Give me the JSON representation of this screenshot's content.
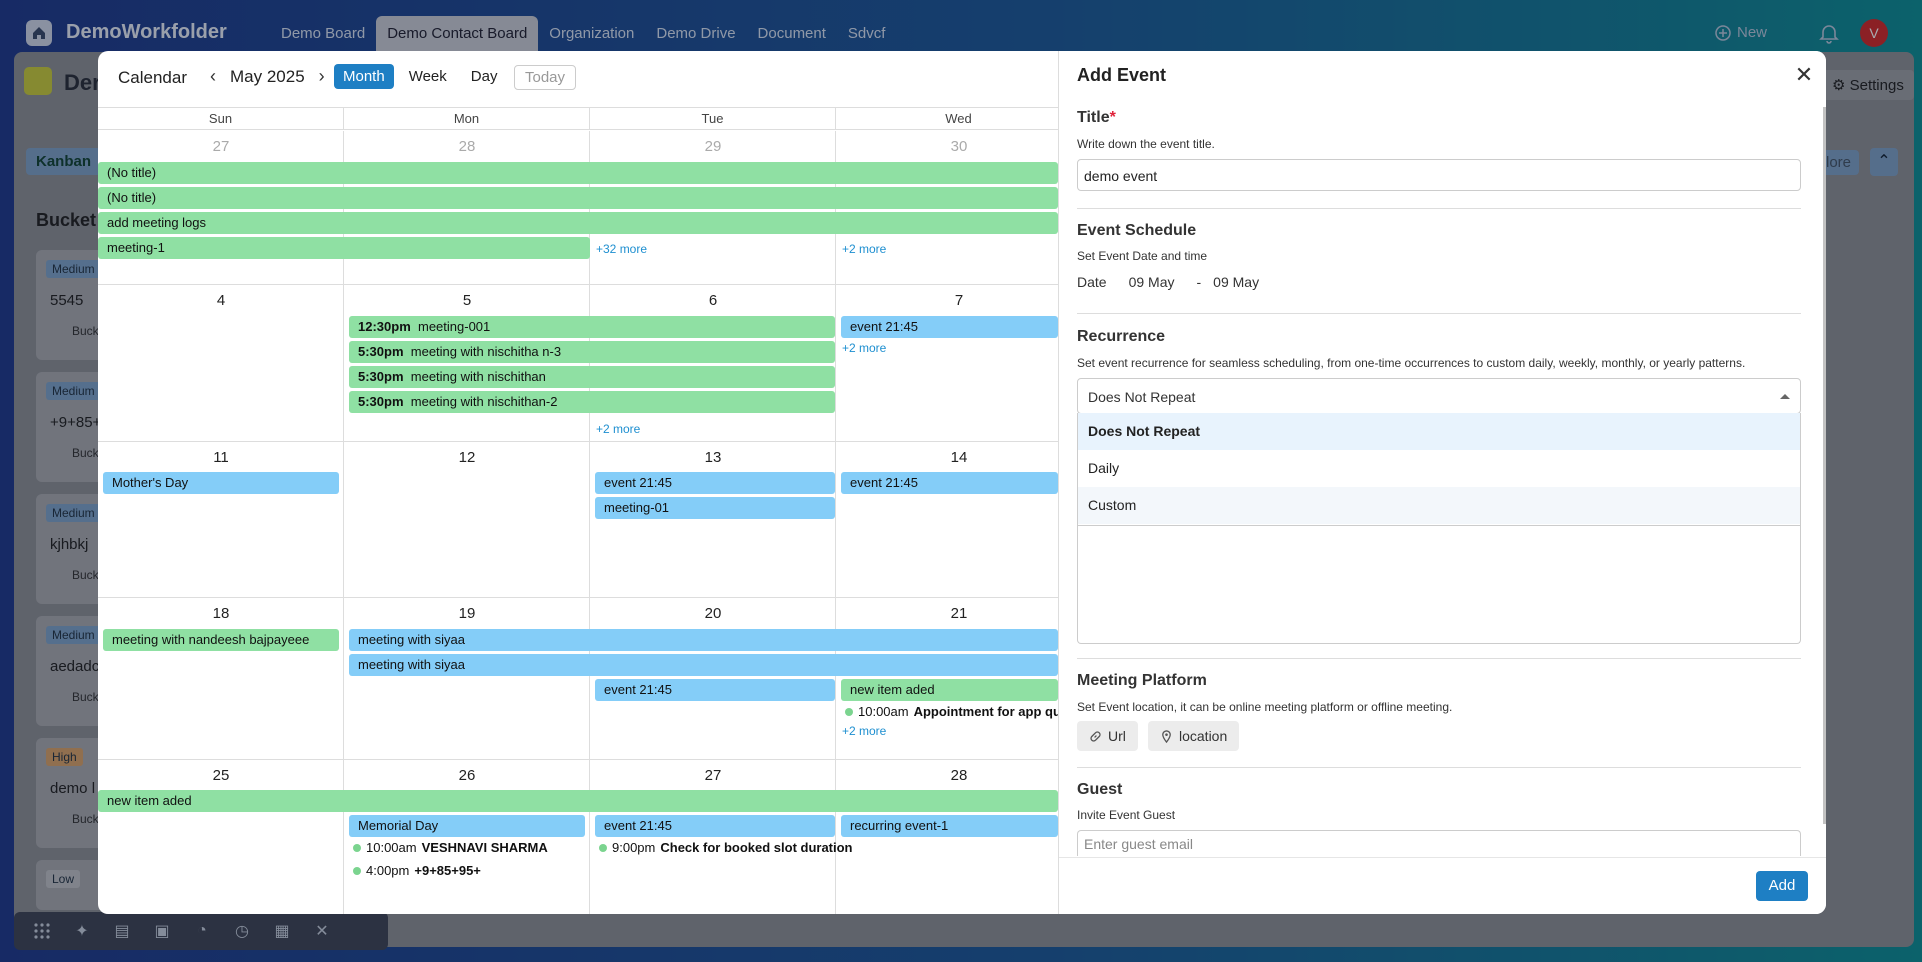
{
  "app": {
    "name": "DemoWorkfolder"
  },
  "nav_tabs": [
    {
      "label": "Demo Board"
    },
    {
      "label": "Demo Contact Board"
    },
    {
      "label": "Organization"
    },
    {
      "label": "Demo Drive"
    },
    {
      "label": "Document"
    },
    {
      "label": "Sdvcf"
    }
  ],
  "header_right": {
    "new_label": "New",
    "avatar_initial": "V"
  },
  "background": {
    "page_title_fragment": "Der",
    "settings_label": "Settings",
    "kanban_label": "Kanban",
    "more_fragment": "lore",
    "bucket_title": "Bucket",
    "cards": [
      {
        "priority": "Medium",
        "title": "5545",
        "bucket": "Buck"
      },
      {
        "priority": "Medium",
        "title": "+9+85+",
        "bucket": "Buck"
      },
      {
        "priority": "Medium",
        "title": "kjhbkj",
        "bucket": "Buck"
      },
      {
        "priority": "Medium",
        "title": "aedadc",
        "bucket": "Buck"
      },
      {
        "priority": "High",
        "title": "demo l",
        "bucket": "Buck"
      },
      {
        "priority": "Low",
        "title": "",
        "bucket": ""
      }
    ]
  },
  "calendar": {
    "title": "Calendar",
    "month_label": "May 2025",
    "views": [
      "Month",
      "Week",
      "Day"
    ],
    "active_view": "Month",
    "today_label": "Today",
    "days_of_week": [
      "Sun",
      "Mon",
      "Tue",
      "Wed"
    ],
    "weeks": [
      {
        "days": [
          "27",
          "28",
          "29",
          "30"
        ]
      },
      {
        "days": [
          "4",
          "5",
          "6",
          "7"
        ]
      },
      {
        "days": [
          "11",
          "12",
          "13",
          "14"
        ]
      },
      {
        "days": [
          "18",
          "19",
          "20",
          "21"
        ]
      },
      {
        "days": [
          "25",
          "26",
          "27",
          "28"
        ]
      }
    ],
    "events": {
      "w1": [
        "(No title)",
        "(No title)",
        "add meeting logs",
        "meeting-1"
      ],
      "w1_more": [
        "+32 more",
        "+2 more"
      ],
      "w2": [
        {
          "time": "12:30pm",
          "title": "meeting-001"
        },
        {
          "time": "5:30pm",
          "title": "meeting with nischitha n-3"
        },
        {
          "time": "5:30pm",
          "title": "meeting with nischithan"
        },
        {
          "time": "5:30pm",
          "title": "meeting with nischithan-2"
        }
      ],
      "w2_wed": "event 21:45",
      "w2_more": [
        "+2 more",
        "+2 more"
      ],
      "w3": [
        "Mother's Day",
        "event 21:45",
        "meeting-01",
        "event 21:45"
      ],
      "w4": [
        "meeting with nandeesh bajpayeee",
        "meeting with siyaa",
        "meeting with siyaa",
        "event 21:45",
        "new item aded"
      ],
      "w4_dot": {
        "time": "10:00am",
        "title": "Appointment for app query"
      },
      "w4_more": "+2 more",
      "w5_bar": "new item aded",
      "w5": [
        "Memorial Day",
        "event 21:45",
        "recurring event-1"
      ],
      "w5_dots": [
        {
          "time": "10:00am",
          "title": "VESHNAVI SHARMA"
        },
        {
          "time": "4:00pm",
          "title": "+9+85+95+"
        },
        {
          "time": "9:00pm",
          "title": "Check for booked slot duration"
        }
      ]
    }
  },
  "add_event": {
    "heading": "Add Event",
    "title_label": "Title",
    "required_mark": "*",
    "title_hint": "Write down the event title.",
    "title_value": "demo event",
    "schedule_label": "Event Schedule",
    "schedule_hint": "Set Event Date and time",
    "date_label": "Date",
    "date_from": "09 May",
    "date_sep": "-",
    "date_to": "09 May",
    "recurrence_label": "Recurrence",
    "recurrence_hint": "Set event recurrence for seamless scheduling, from one-time occurrences to custom daily, weekly, monthly, or yearly patterns.",
    "recurrence_value": "Does Not Repeat",
    "recurrence_options": [
      "Does Not Repeat",
      "Daily",
      "Custom"
    ],
    "platform_label": "Meeting Platform",
    "platform_hint": "Set Event location, it can be online meeting platform or offline meeting.",
    "platform_buttons": [
      "Url",
      "location"
    ],
    "guest_label": "Guest",
    "guest_hint": "Invite Event Guest",
    "guest_placeholder": "Enter guest email",
    "add_label": "Add"
  }
}
